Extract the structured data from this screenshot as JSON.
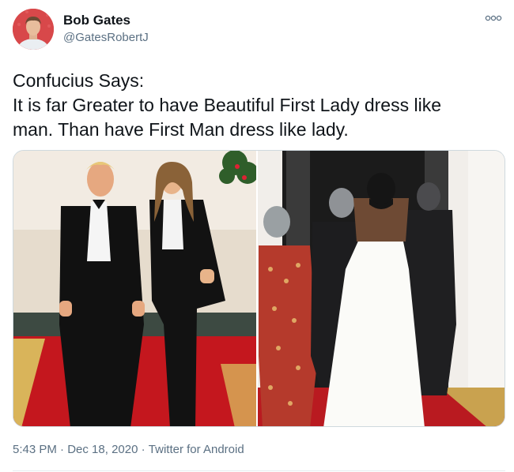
{
  "author": {
    "name": "Bob Gates",
    "handle": "@GatesRobertJ",
    "avatar_icon": "profile-photo"
  },
  "more_icon": "more-options-icon",
  "tweet": {
    "lines": [
      "Confucius Says:",
      "It is far Greater to have Beautiful First Lady dress like",
      "man. Than have First Man dress like lady."
    ]
  },
  "media": {
    "type": "photo-collage",
    "panels": [
      "couple-in-tuxedos-red-carpet",
      "group-walking-away-white-gown"
    ]
  },
  "meta": {
    "time": "5:43 PM",
    "separator": "·",
    "date": "Dec 18, 2020",
    "source": "Twitter for Android"
  },
  "colors": {
    "text": "#0f1419",
    "secondary": "#5b7083",
    "border": "#cfd9de",
    "carpet": "#c8102e"
  }
}
